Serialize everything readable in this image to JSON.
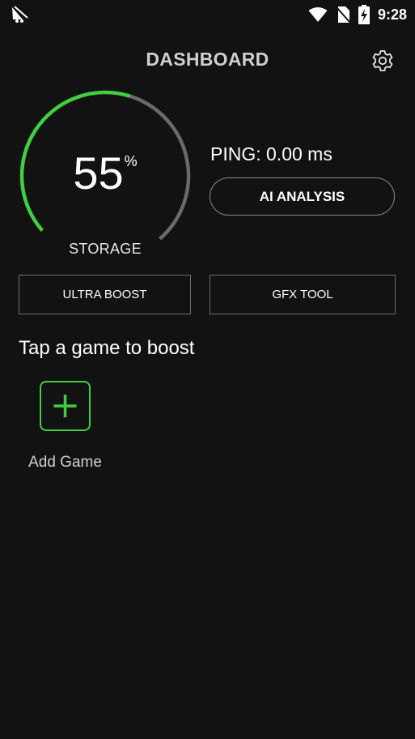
{
  "status_bar": {
    "time": "9:28",
    "left_icon": "app-notification-icon",
    "right_icons": [
      "wifi-icon",
      "no-sim-icon",
      "battery-charging-icon"
    ]
  },
  "header": {
    "title": "DASHBOARD",
    "settings_icon": "gear-icon"
  },
  "gauge": {
    "value": "55",
    "unit": "%",
    "label": "STORAGE",
    "fraction": 0.55,
    "colors": {
      "active": "#3fcf3f",
      "track": "#6a6a6a"
    }
  },
  "network": {
    "ping_text": "PING: 0.00 ms",
    "ai_button_label": "AI ANALYSIS"
  },
  "actions": {
    "ultra_boost_label": "ULTRA BOOST",
    "gfx_tool_label": "GFX TOOL"
  },
  "games": {
    "heading": "Tap a game to boost",
    "add_label": "Add Game",
    "add_icon": "plus-icon",
    "accent": "#3fcf3f"
  },
  "theme": {
    "background": "#121212",
    "title_color": "#cfcfcf"
  }
}
